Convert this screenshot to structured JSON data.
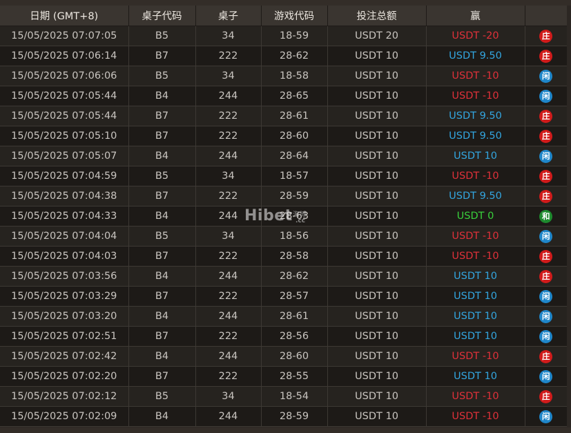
{
  "table": {
    "headers": [
      "日期 (GMT+8)",
      "桌子代码",
      "桌子",
      "游戏代码",
      "投注总额",
      "赢",
      ""
    ],
    "rows": [
      {
        "date": "15/05/2025 07:07:05",
        "table_code": "B5",
        "table": "34",
        "game_code": "18-59",
        "bet": "USDT 20",
        "win": "USDT -20",
        "win_type": "loss",
        "result": "庄",
        "result_type": "banker"
      },
      {
        "date": "15/05/2025 07:06:14",
        "table_code": "B7",
        "table": "222",
        "game_code": "28-62",
        "bet": "USDT 10",
        "win": "USDT 9.50",
        "win_type": "gain",
        "result": "庄",
        "result_type": "banker"
      },
      {
        "date": "15/05/2025 07:06:06",
        "table_code": "B5",
        "table": "34",
        "game_code": "18-58",
        "bet": "USDT 10",
        "win": "USDT -10",
        "win_type": "loss",
        "result": "闲",
        "result_type": "player"
      },
      {
        "date": "15/05/2025 07:05:44",
        "table_code": "B4",
        "table": "244",
        "game_code": "28-65",
        "bet": "USDT 10",
        "win": "USDT -10",
        "win_type": "loss",
        "result": "闲",
        "result_type": "player"
      },
      {
        "date": "15/05/2025 07:05:44",
        "table_code": "B7",
        "table": "222",
        "game_code": "28-61",
        "bet": "USDT 10",
        "win": "USDT 9.50",
        "win_type": "gain",
        "result": "庄",
        "result_type": "banker"
      },
      {
        "date": "15/05/2025 07:05:10",
        "table_code": "B7",
        "table": "222",
        "game_code": "28-60",
        "bet": "USDT 10",
        "win": "USDT 9.50",
        "win_type": "gain",
        "result": "庄",
        "result_type": "banker"
      },
      {
        "date": "15/05/2025 07:05:07",
        "table_code": "B4",
        "table": "244",
        "game_code": "28-64",
        "bet": "USDT 10",
        "win": "USDT 10",
        "win_type": "gain",
        "result": "闲",
        "result_type": "player"
      },
      {
        "date": "15/05/2025 07:04:59",
        "table_code": "B5",
        "table": "34",
        "game_code": "18-57",
        "bet": "USDT 10",
        "win": "USDT -10",
        "win_type": "loss",
        "result": "庄",
        "result_type": "banker"
      },
      {
        "date": "15/05/2025 07:04:38",
        "table_code": "B7",
        "table": "222",
        "game_code": "28-59",
        "bet": "USDT 10",
        "win": "USDT 9.50",
        "win_type": "gain",
        "result": "庄",
        "result_type": "banker"
      },
      {
        "date": "15/05/2025 07:04:33",
        "table_code": "B4",
        "table": "244",
        "game_code": "28-63",
        "bet": "USDT 10",
        "win": "USDT 0",
        "win_type": "tie",
        "result": "和",
        "result_type": "tie"
      },
      {
        "date": "15/05/2025 07:04:04",
        "table_code": "B5",
        "table": "34",
        "game_code": "18-56",
        "bet": "USDT 10",
        "win": "USDT -10",
        "win_type": "loss",
        "result": "闲",
        "result_type": "player"
      },
      {
        "date": "15/05/2025 07:04:03",
        "table_code": "B7",
        "table": "222",
        "game_code": "28-58",
        "bet": "USDT 10",
        "win": "USDT -10",
        "win_type": "loss",
        "result": "庄",
        "result_type": "banker"
      },
      {
        "date": "15/05/2025 07:03:56",
        "table_code": "B4",
        "table": "244",
        "game_code": "28-62",
        "bet": "USDT 10",
        "win": "USDT 10",
        "win_type": "gain",
        "result": "庄",
        "result_type": "banker"
      },
      {
        "date": "15/05/2025 07:03:29",
        "table_code": "B7",
        "table": "222",
        "game_code": "28-57",
        "bet": "USDT 10",
        "win": "USDT 10",
        "win_type": "gain",
        "result": "闲",
        "result_type": "player"
      },
      {
        "date": "15/05/2025 07:03:20",
        "table_code": "B4",
        "table": "244",
        "game_code": "28-61",
        "bet": "USDT 10",
        "win": "USDT 10",
        "win_type": "gain",
        "result": "闲",
        "result_type": "player"
      },
      {
        "date": "15/05/2025 07:02:51",
        "table_code": "B7",
        "table": "222",
        "game_code": "28-56",
        "bet": "USDT 10",
        "win": "USDT 10",
        "win_type": "gain",
        "result": "闲",
        "result_type": "player"
      },
      {
        "date": "15/05/2025 07:02:42",
        "table_code": "B4",
        "table": "244",
        "game_code": "28-60",
        "bet": "USDT 10",
        "win": "USDT -10",
        "win_type": "loss",
        "result": "庄",
        "result_type": "banker"
      },
      {
        "date": "15/05/2025 07:02:20",
        "table_code": "B7",
        "table": "222",
        "game_code": "28-55",
        "bet": "USDT 10",
        "win": "USDT 10",
        "win_type": "gain",
        "result": "闲",
        "result_type": "player"
      },
      {
        "date": "15/05/2025 07:02:12",
        "table_code": "B5",
        "table": "34",
        "game_code": "18-54",
        "bet": "USDT 10",
        "win": "USDT -10",
        "win_type": "loss",
        "result": "庄",
        "result_type": "banker"
      },
      {
        "date": "15/05/2025 07:02:09",
        "table_code": "B4",
        "table": "244",
        "game_code": "28-59",
        "bet": "USDT 10",
        "win": "USDT -10",
        "win_type": "loss",
        "result": "闲",
        "result_type": "player"
      }
    ]
  },
  "watermark": {
    "brand": "Hibet",
    "sub": "海博",
    "tld": ".cc"
  },
  "colors": {
    "loss": "#e0313a",
    "gain": "#33a6e0",
    "tie": "#39d13c",
    "banker_badge": "#d11b1b",
    "player_badge": "#1f86c9",
    "tie_badge": "#1e8a2e"
  }
}
